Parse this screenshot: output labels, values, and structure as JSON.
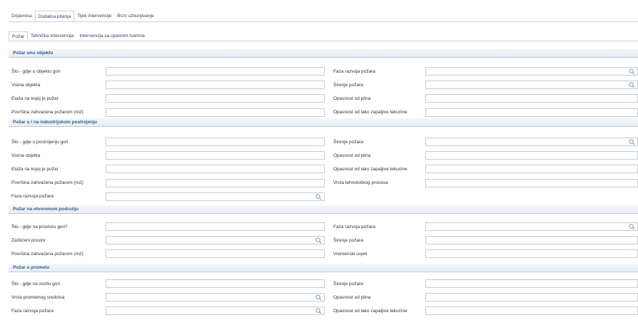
{
  "outer_tabs": [
    "Dojavnica",
    "Dodatna pitanja",
    "Tijek intervencije",
    "Brzo uzbunjivanje"
  ],
  "outer_active": 1,
  "inner_tabs": [
    "Požar",
    "Tehnička intervencija",
    "Intervencija sa opasnim tvarima"
  ],
  "inner_active": 0,
  "sections": [
    {
      "title": "Požar unu objektu",
      "left": [
        {
          "label": "Što - gdje u objektu gori",
          "value": "",
          "lookup": false
        },
        {
          "label": "Visina objekta",
          "value": "",
          "lookup": false
        },
        {
          "label": "Etaža na kojoj je požar",
          "value": "",
          "lookup": false
        },
        {
          "label": "Površina zahvaćena požarom (m2)",
          "value": "",
          "lookup": false
        }
      ],
      "right": [
        {
          "label": "Faza razvoja požara",
          "value": "",
          "lookup": true
        },
        {
          "label": "Širenje požara",
          "value": "",
          "lookup": true
        },
        {
          "label": "Opasnost od plina",
          "value": "",
          "lookup": false
        },
        {
          "label": "Opasnost od lako zapaljive tekućine",
          "value": "",
          "lookup": false
        }
      ]
    },
    {
      "title": "Požar u / na industrijskom postrojenju",
      "left": [
        {
          "label": "Što - gdje u postrojenju gori",
          "value": "",
          "lookup": false
        },
        {
          "label": "Visina objekta",
          "value": "",
          "lookup": false
        },
        {
          "label": "Etaža na kojoj je požar",
          "value": "",
          "lookup": false
        },
        {
          "label": "Površina zahvaćena požarom (m2)",
          "value": "",
          "lookup": false
        },
        {
          "label": "Faza razvoja požara",
          "value": "",
          "lookup": true
        }
      ],
      "right": [
        {
          "label": "Širenje požara",
          "value": "",
          "lookup": true
        },
        {
          "label": "Opasnost od plina",
          "value": "",
          "lookup": false
        },
        {
          "label": "Opasnost od lako zapaljive tekućine",
          "value": "",
          "lookup": false
        },
        {
          "label": "Vrsta tehnološkog procesa",
          "value": "",
          "lookup": false
        }
      ]
    },
    {
      "title": "Požar na otvorenom području",
      "left": [
        {
          "label": "Što - gdje na prostoru gori?",
          "value": "",
          "lookup": false
        },
        {
          "label": "Zaštićeni prostor",
          "value": "",
          "lookup": true
        },
        {
          "label": "Površina zahvaćena požarom (m2)",
          "value": "",
          "lookup": false
        }
      ],
      "right": [
        {
          "label": "Faza razvoja požara",
          "value": "",
          "lookup": true
        },
        {
          "label": "Širenje požara",
          "value": "",
          "lookup": false
        },
        {
          "label": "Vremenski uvjeti",
          "value": "",
          "lookup": false
        }
      ]
    },
    {
      "title": "Požar u prometu",
      "left": [
        {
          "label": "Što - gdje na vozilu gori",
          "value": "",
          "lookup": false
        },
        {
          "label": "Vrsta prometnog sredstva",
          "value": "",
          "lookup": true
        },
        {
          "label": "Faza razvoja požara",
          "value": "",
          "lookup": true
        }
      ],
      "right": [
        {
          "label": "Širenje požara",
          "value": "",
          "lookup": false
        },
        {
          "label": "Opasnost od plina",
          "value": "",
          "lookup": false
        },
        {
          "label": "Opasnost od lako zapaljive tekućine",
          "value": "",
          "lookup": false
        }
      ]
    }
  ],
  "icons": {
    "lookup": "magnifier-icon"
  }
}
